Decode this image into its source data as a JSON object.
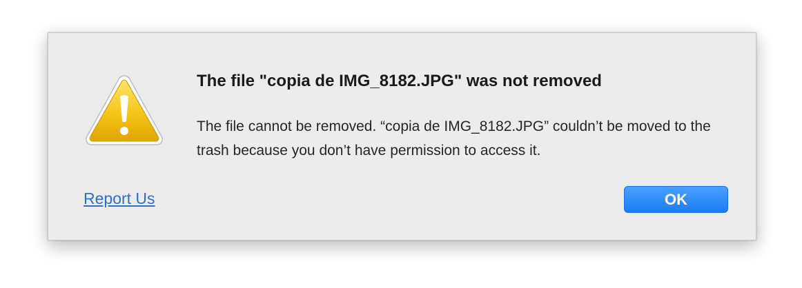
{
  "dialog": {
    "icon": "warning-icon",
    "title": "The file \"copia de IMG_8182.JPG\" was not removed",
    "message": "The file cannot be removed. “copia de IMG_8182.JPG” couldn’t be moved to the trash because you don’t have permission to access it.",
    "report_link": "Report Us",
    "ok_label": "OK"
  },
  "colors": {
    "dialog_bg": "#ececec",
    "link": "#2f6fc8",
    "button": "#1c7cf4",
    "warning": "#f2c21b"
  }
}
